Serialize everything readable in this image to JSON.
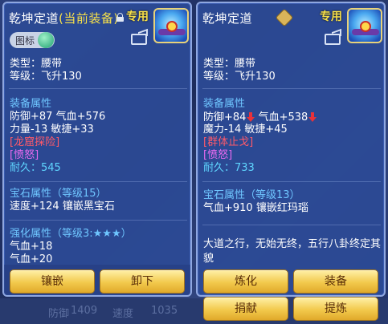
{
  "background": {
    "bottom_left_label": "防御",
    "bottom_left_value": "1409",
    "bottom_right_label": "速度",
    "bottom_right_value": "1035"
  },
  "left_panel": {
    "title_name": "乾坤定道",
    "title_status": "(当前装备)",
    "special_tag": "专用",
    "chip_label": "图标",
    "type_line": "类型：腰带",
    "level_line": "等级：飞升130",
    "equip_attr_header": "装备属性",
    "equip_attr_line1": "防御+87 气血+576",
    "equip_attr_line2": "力量-13 敏捷+33",
    "special_skill": "[龙窟探险]",
    "special_effect": "[愤怒]",
    "durability_label": "耐久：",
    "durability_value": "545",
    "gem_header": "宝石属性（等级15）",
    "gem_line": "速度+124 镶嵌黑宝石",
    "enhance_header": "强化属性（等级3:★★★）",
    "enhance_line1": "气血+18",
    "enhance_line2": "气血+20",
    "button_inlay": "镶嵌",
    "button_unequip": "卸下"
  },
  "right_panel": {
    "title_name": "乾坤定道",
    "special_tag": "专用",
    "type_line": "类型：腰带",
    "level_line": "等级：飞升130",
    "equip_attr_header": "装备属性",
    "equip_attr_defense": "防御+84",
    "equip_attr_hp": "气血+538",
    "equip_attr_line2": "魔力-14 敏捷+45",
    "special_skill": "[群体止戈]",
    "special_effect": "[愤怒]",
    "durability_label": "耐久：",
    "durability_value": "733",
    "gem_header": "宝石属性（等级13）",
    "gem_line": "气血+910 镶嵌红玛瑙",
    "description": "大道之行，无始无终，五行八卦终定其貌",
    "button_refine": "炼化",
    "button_equip": "装备",
    "button_donate": "捐献",
    "button_extract": "提炼"
  },
  "colors": {
    "section_blue": "#6fc6ff",
    "special_red": "#ff5a6a",
    "effect_magenta": "#e86af0",
    "durability_cyan": "#5fd6ff",
    "title_yellow": "#f7e04a",
    "button_gold": "#f2c94c"
  },
  "icons": [
    "lock-icon",
    "item-belt-icon",
    "share-icon",
    "down-arrow-icon",
    "coin-icon",
    "jade-orb-icon"
  ]
}
